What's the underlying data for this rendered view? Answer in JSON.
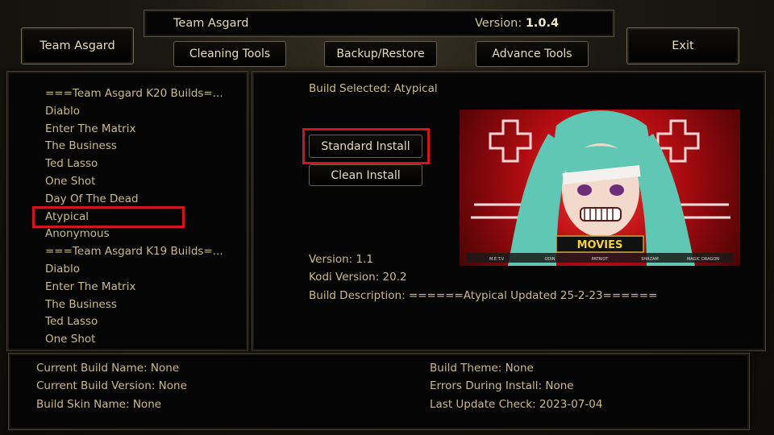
{
  "header": {
    "app_title": "Team Asgard",
    "version_label": "Version:",
    "version_value": "1.0.4"
  },
  "nav": {
    "team_button": "Team Asgard",
    "cleaning_tools": "Cleaning Tools",
    "backup_restore": "Backup/Restore",
    "advance_tools": "Advance Tools",
    "exit": "Exit"
  },
  "build_list": {
    "items": [
      {
        "label": "===Team Asgard K20 Builds=..."
      },
      {
        "label": "Diablo"
      },
      {
        "label": "Enter The Matrix"
      },
      {
        "label": "The Business"
      },
      {
        "label": "Ted Lasso"
      },
      {
        "label": "One Shot"
      },
      {
        "label": "Day Of The Dead"
      },
      {
        "label": "Atypical"
      },
      {
        "label": "Anonymous"
      },
      {
        "label": "===Team Asgard K19 Builds=..."
      },
      {
        "label": "Diablo"
      },
      {
        "label": "Enter The Matrix"
      },
      {
        "label": "The Business"
      },
      {
        "label": "Ted Lasso"
      },
      {
        "label": "One Shot"
      }
    ],
    "highlighted": "Atypical"
  },
  "details": {
    "build_selected": "Build Selected: Atypical",
    "standard_install": "Standard Install",
    "clean_install": "Clean Install",
    "version": "Version: 1.1",
    "kodi_version": "Kodi Version: 20.2",
    "description": "Build Description: ======Atypical Updated 25-2-23======"
  },
  "preview": {
    "menu_label": "MOVIES",
    "menu_items": [
      "M.E.T.V",
      "ODIN",
      "PATRIOT",
      "SHAZAM",
      "MAGIC DRAGON"
    ]
  },
  "footer": {
    "current_build_name": "Current Build Name: None",
    "current_build_version": "Current Build Version: None",
    "build_skin_name": "Build Skin Name: None",
    "build_theme": "Build Theme: None",
    "errors_during_install": "Errors During Install: None",
    "last_update_check": "Last Update Check: 2023-07-04"
  },
  "colors": {
    "accent_text": "#cdb98c",
    "highlight_box": "#d4131b",
    "panel_bg": "#050505"
  }
}
